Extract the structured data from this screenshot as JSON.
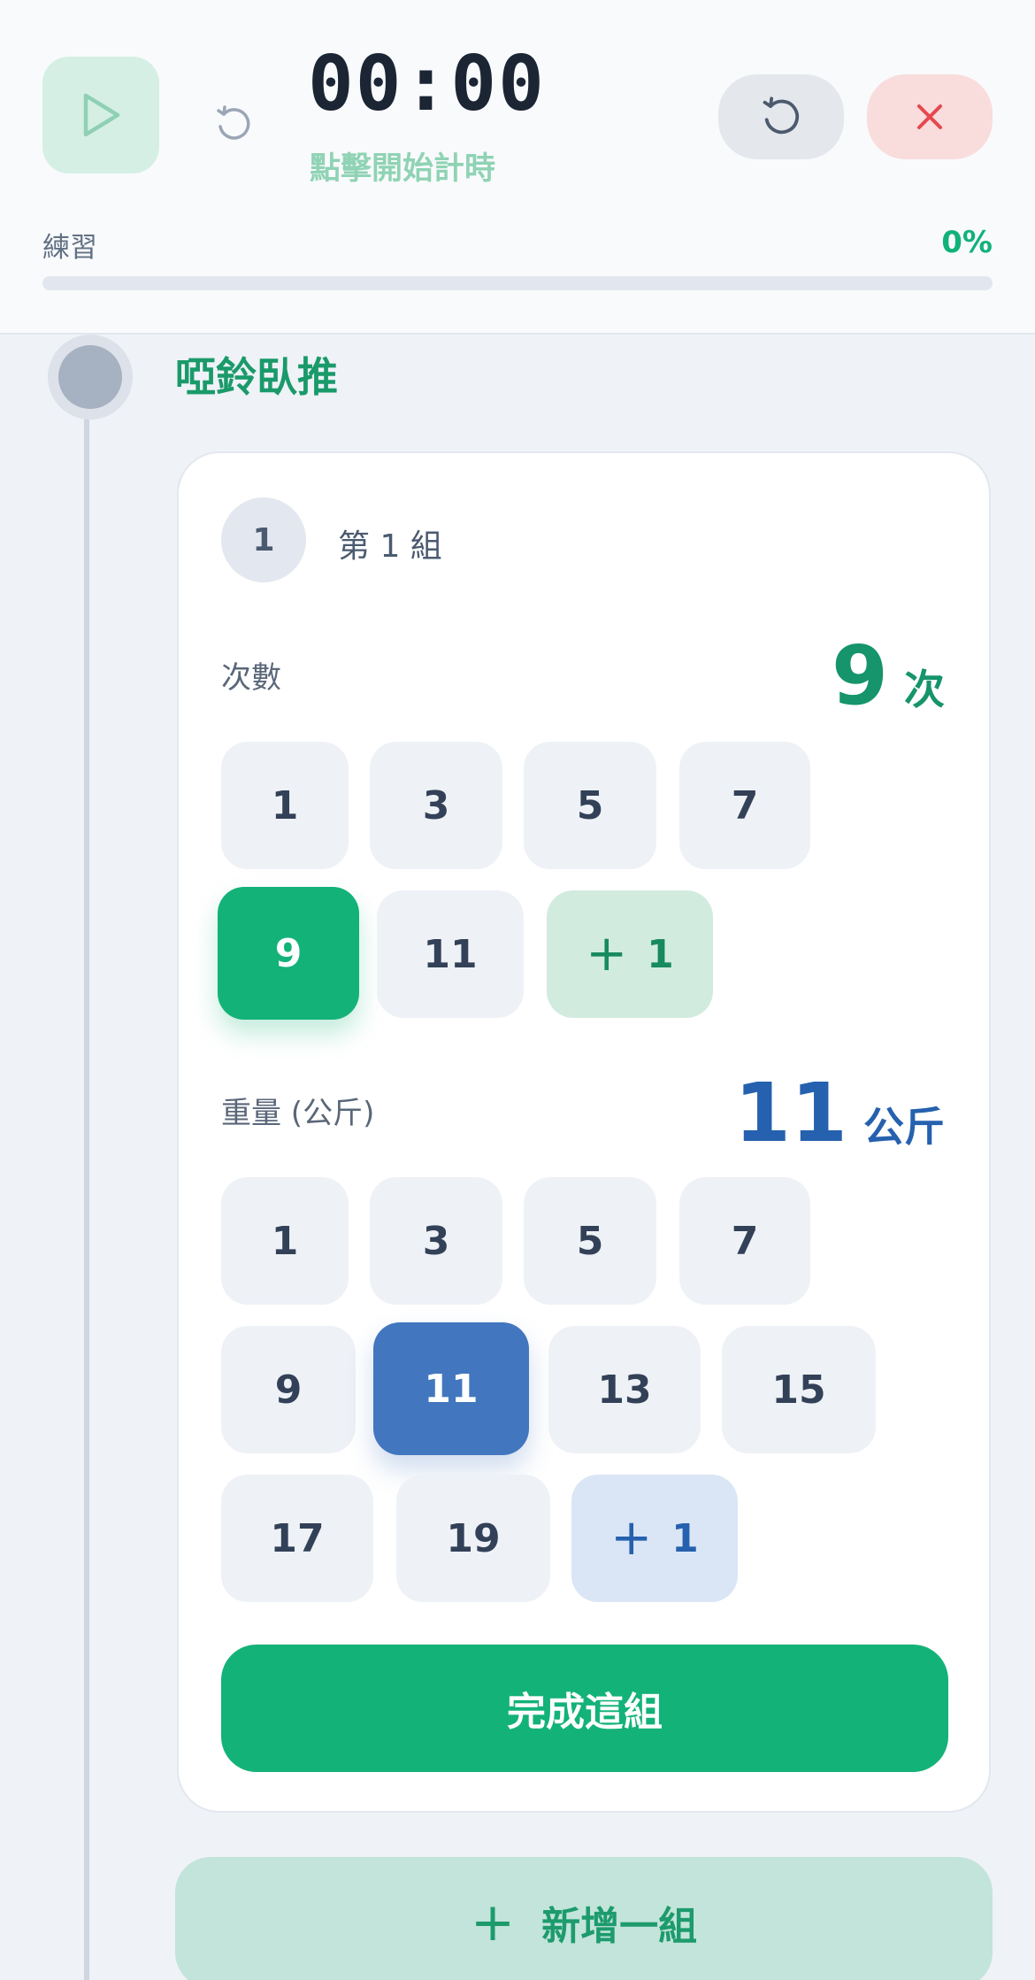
{
  "header": {
    "timer": "00:00",
    "timer_hint": "點擊開始計時",
    "progress_label": "練習",
    "progress_percent_text": "0%",
    "progress_fraction": 0.0
  },
  "exercise": {
    "title": "啞鈴臥推"
  },
  "set": {
    "number": "1",
    "label": "第 1 組",
    "reps": {
      "label": "次數",
      "value": "9",
      "unit": "次",
      "options": [
        "1",
        "3",
        "5",
        "7",
        "9",
        "11"
      ],
      "selected": "9",
      "increment_label": "1"
    },
    "weight": {
      "label": "重量 (公斤)",
      "value": "11",
      "unit": "公斤",
      "options": [
        "1",
        "3",
        "5",
        "7",
        "9",
        "11",
        "13",
        "15",
        "17",
        "19"
      ],
      "selected": "11",
      "increment_label": "1"
    },
    "complete_label": "完成這組"
  },
  "add_set_label": "新增一組",
  "icons": {
    "play": "play-icon",
    "small_reset": "reset-icon",
    "reset": "reset-icon",
    "close": "close-icon",
    "plus": "plus-icon"
  },
  "colors": {
    "accent_green": "#13b279",
    "accent_blue": "#4277bf",
    "danger": "#e5484d"
  }
}
